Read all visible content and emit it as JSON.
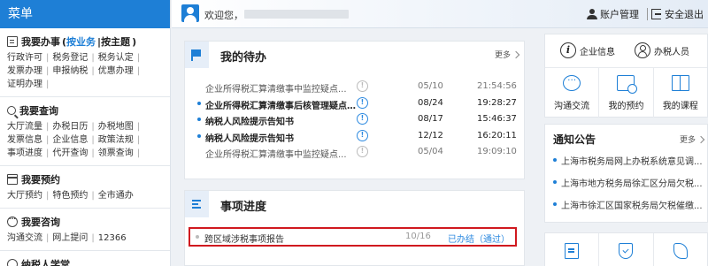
{
  "sidebar": {
    "title": "菜单",
    "sections": [
      {
        "title": "我要办事",
        "options": {
          "open": "(",
          "active": "按业务",
          "sep": "|",
          "other": "按主题",
          "close": ")"
        },
        "links": [
          "行政许可",
          "税务登记",
          "税务认定",
          "发票办理",
          "申报纳税",
          "优惠办理",
          "证明办理"
        ]
      },
      {
        "title": "我要查询",
        "links": [
          "大厅流量",
          "办税日历",
          "办税地图",
          "发票信息",
          "企业信息",
          "政策法规",
          "事项进度",
          "代开查询",
          "领票查询"
        ]
      },
      {
        "title": "我要预约",
        "links": [
          "大厅预约",
          "特色预约",
          "全市通办"
        ]
      },
      {
        "title": "我要咨询",
        "links": [
          "沟通交流",
          "网上提问",
          "12366"
        ]
      },
      {
        "title": "纳税人学堂",
        "links": []
      }
    ]
  },
  "topbar": {
    "welcome": "欢迎您，",
    "account_label": "账户管理",
    "logout_label": "安全退出"
  },
  "todo": {
    "title": "我的待办",
    "more": "更多",
    "items": [
      {
        "title": "企业所得税汇算清缴事中监控疑点...",
        "date": "05/10",
        "time": "21:54:56",
        "read": true
      },
      {
        "title": "企业所得税汇算清缴事后核管理疑点...",
        "date": "08/24",
        "time": "19:28:27",
        "read": false
      },
      {
        "title": "纳税人风险提示告知书",
        "date": "08/17",
        "time": "15:46:37",
        "read": false
      },
      {
        "title": "纳税人风险提示告知书",
        "date": "12/12",
        "time": "16:20:11",
        "read": false
      },
      {
        "title": "企业所得税汇算清缴事中监控疑点...",
        "date": "05/04",
        "time": "19:09:10",
        "read": true
      }
    ]
  },
  "progress": {
    "title": "事项进度",
    "items": [
      {
        "name": "跨区域涉税事项报告",
        "count": "10/16",
        "status": "已办结（通过）"
      }
    ]
  },
  "quick": {
    "company_info": "企业信息",
    "taxpayer_staff": "办税人员",
    "cells": [
      {
        "label": "沟通交流",
        "icon": "chat-bubble-icon"
      },
      {
        "label": "我的预约",
        "icon": "calendar-clock-icon"
      },
      {
        "label": "我的课程",
        "icon": "book-icon"
      }
    ]
  },
  "notice": {
    "title": "通知公告",
    "more": "更多",
    "items": [
      "上海市税务局网上办税系统意见调...",
      "上海市地方税务局徐汇区分局欠税...",
      "上海市徐汇区国家税务局欠税催缴..."
    ]
  },
  "bottom_icons": [
    "report-icon",
    "shield-check-icon",
    "phone-icon"
  ],
  "colors": {
    "brand_blue": "#1e7fd6",
    "highlight_red": "#d0191f",
    "status_blue": "#2d8ae0"
  }
}
